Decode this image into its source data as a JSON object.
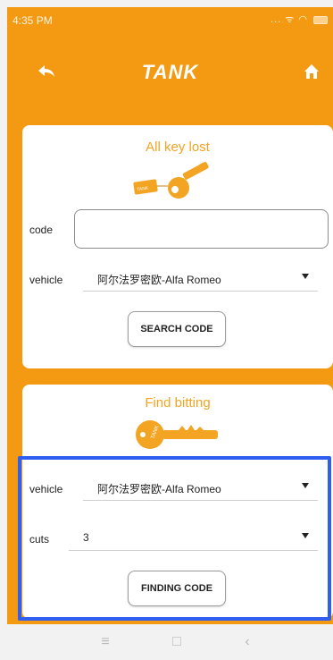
{
  "status_bar": {
    "time": "4:35 PM",
    "icons_text": "... ᯤ ◠"
  },
  "header": {
    "title": "TANK",
    "back_icon": "back-arrow-icon",
    "home_icon": "home-icon"
  },
  "all_key_lost": {
    "title": "All key lost",
    "code_label": "code",
    "code_value": "",
    "vehicle_label": "vehicle",
    "vehicle_value": "阿尔法罗密欧-Alfa Romeo",
    "search_button": "SEARCH CODE"
  },
  "find_bitting": {
    "title": "Find bitting",
    "vehicle_label": "vehicle",
    "vehicle_value": "阿尔法罗密欧-Alfa Romeo",
    "cuts_label": "cuts",
    "cuts_value": "3",
    "finding_button": "FINDING CODE"
  },
  "nav": {
    "menu_glyph": "≡",
    "home_glyph": "□",
    "back_glyph": "‹"
  },
  "colors": {
    "app_bg": "#f39a12",
    "accent_text": "#f2a422",
    "highlight": "#2e5ff0"
  }
}
